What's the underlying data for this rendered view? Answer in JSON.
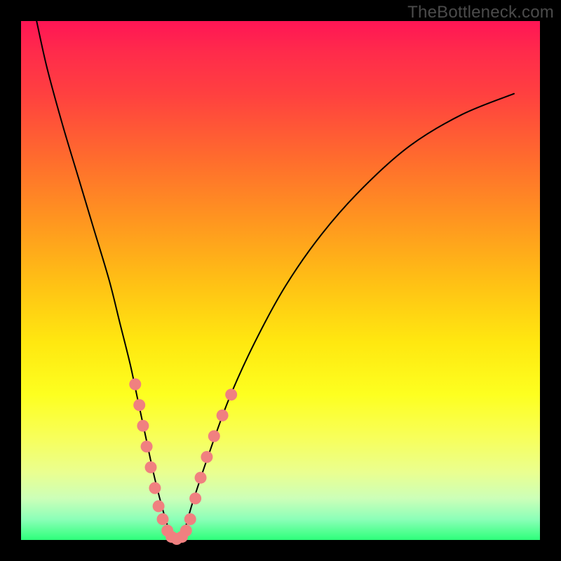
{
  "watermark": "TheBottleneck.com",
  "chart_data": {
    "type": "line",
    "title": "",
    "xlabel": "",
    "ylabel": "",
    "xlim": [
      0,
      100
    ],
    "ylim": [
      0,
      100
    ],
    "series": [
      {
        "name": "bottleneck-curve",
        "x": [
          3,
          5,
          8,
          11,
          14,
          17,
          19,
          21,
          22.5,
          24,
          25.5,
          27,
          28.5,
          30,
          31.5,
          33,
          36,
          40,
          45,
          51,
          58,
          66,
          75,
          85,
          95
        ],
        "y": [
          100,
          91,
          80,
          70,
          60,
          50,
          42,
          34,
          27,
          20,
          13,
          7,
          2,
          0,
          2,
          7,
          16,
          27,
          38,
          49,
          59,
          68,
          76,
          82,
          86
        ]
      }
    ],
    "markers": {
      "name": "highlight-dots",
      "color": "#f08080",
      "points": [
        {
          "x": 22.0,
          "y": 30
        },
        {
          "x": 22.8,
          "y": 26
        },
        {
          "x": 23.5,
          "y": 22
        },
        {
          "x": 24.2,
          "y": 18
        },
        {
          "x": 25.0,
          "y": 14
        },
        {
          "x": 25.8,
          "y": 10
        },
        {
          "x": 26.5,
          "y": 6.5
        },
        {
          "x": 27.3,
          "y": 4
        },
        {
          "x": 28.2,
          "y": 1.8
        },
        {
          "x": 29.0,
          "y": 0.6
        },
        {
          "x": 30.0,
          "y": 0.2
        },
        {
          "x": 31.0,
          "y": 0.6
        },
        {
          "x": 31.8,
          "y": 1.8
        },
        {
          "x": 32.6,
          "y": 4
        },
        {
          "x": 33.6,
          "y": 8
        },
        {
          "x": 34.6,
          "y": 12
        },
        {
          "x": 35.8,
          "y": 16
        },
        {
          "x": 37.2,
          "y": 20
        },
        {
          "x": 38.8,
          "y": 24
        },
        {
          "x": 40.5,
          "y": 28
        }
      ]
    },
    "background_gradient": {
      "top": "#ff1555",
      "middle": "#ffe810",
      "bottom": "#2dff7a"
    }
  }
}
